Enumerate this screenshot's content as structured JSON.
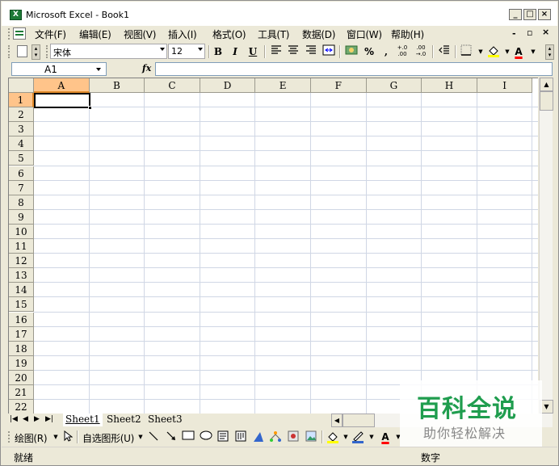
{
  "window": {
    "title": "Microsoft Excel - Book1",
    "app_icon": "excel-icon",
    "app_icon_glyph": "X"
  },
  "caption_buttons": [
    {
      "name": "minimize",
      "glyph": "_"
    },
    {
      "name": "maximize",
      "glyph": "□"
    },
    {
      "name": "close",
      "glyph": "×"
    }
  ],
  "menubar": {
    "items": [
      "文件(F)",
      "编辑(E)",
      "视图(V)",
      "插入(I)",
      "格式(O)",
      "工具(T)",
      "数据(D)",
      "窗口(W)",
      "帮助(H)"
    ],
    "doc_controls": {
      "minimize": "-",
      "restore": "▫",
      "close": "×"
    }
  },
  "toolbar": {
    "font_name": "宋体",
    "font_size": "12",
    "bold": "B",
    "italic": "I",
    "underline": "U",
    "percent": "%",
    "comma": ",",
    "inc_decimal": "+.0\n.00",
    "dec_decimal": ".00\n→.0",
    "font_color": "A"
  },
  "formula_bar": {
    "name_box": "A1",
    "fx_label": "fx",
    "formula": ""
  },
  "grid": {
    "columns": [
      "A",
      "B",
      "C",
      "D",
      "E",
      "F",
      "G",
      "H",
      "I"
    ],
    "rows": [
      "1",
      "2",
      "3",
      "4",
      "5",
      "6",
      "7",
      "8",
      "9",
      "10",
      "11",
      "12",
      "13",
      "14",
      "15",
      "16",
      "17",
      "18",
      "19",
      "20",
      "21",
      "22"
    ],
    "active_cell": "A1"
  },
  "sheets": {
    "tabs": [
      "Sheet1",
      "Sheet2",
      "Sheet3"
    ],
    "active": "Sheet1",
    "nav": [
      "|◀",
      "◀",
      "▶",
      "▶|"
    ]
  },
  "drawing_toolbar": {
    "draw_label": "绘图(R)",
    "autoshapes_label": "自选图形(U)"
  },
  "statusbar": {
    "left": "就绪",
    "right": "数字"
  },
  "watermark": {
    "title": "百科全说",
    "subtitle": "助你轻松解决"
  },
  "colors": {
    "active_header": "#ffc48a",
    "chrome": "#ece9d8",
    "grid_line": "#d0d7e5"
  }
}
